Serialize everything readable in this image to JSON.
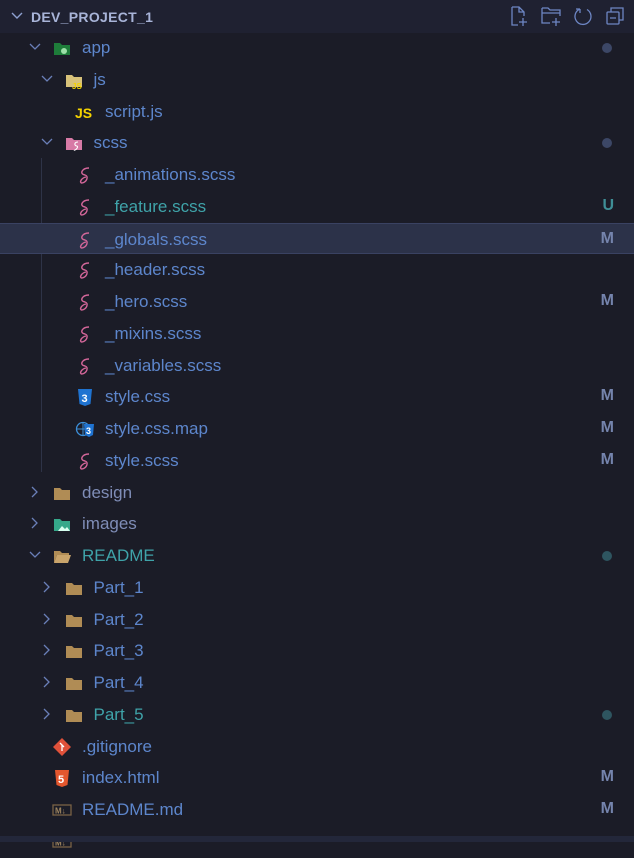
{
  "explorer": {
    "title": "DEV_PROJECT_1",
    "actions": [
      {
        "name": "new-file-button",
        "icon": "new-file-icon"
      },
      {
        "name": "new-folder-button",
        "icon": "new-folder-icon"
      },
      {
        "name": "refresh-button",
        "icon": "refresh-icon"
      },
      {
        "name": "collapse-all-button",
        "icon": "collapse-all-icon"
      }
    ]
  },
  "colors": {
    "accent": "#5d86cc",
    "untracked": "#3fa3a9",
    "selected_bg": "#2c3249"
  },
  "tree": [
    {
      "label": "app",
      "depth": 0,
      "folder": true,
      "expanded": true,
      "icon": "folder-app-icon",
      "marker": "dot"
    },
    {
      "label": "js",
      "depth": 1,
      "folder": true,
      "expanded": true,
      "icon": "folder-js-icon"
    },
    {
      "label": "script.js",
      "depth": 2,
      "icon": "javascript-icon"
    },
    {
      "label": "scss",
      "depth": 1,
      "folder": true,
      "expanded": true,
      "icon": "folder-sass-icon",
      "marker": "dot"
    },
    {
      "label": "_animations.scss",
      "depth": 2,
      "icon": "sass-icon"
    },
    {
      "label": "_feature.scss",
      "depth": 2,
      "icon": "sass-icon",
      "badge": "U",
      "style": "teal"
    },
    {
      "label": "_globals.scss",
      "depth": 2,
      "icon": "sass-icon",
      "badge": "M",
      "selected": true
    },
    {
      "label": "_header.scss",
      "depth": 2,
      "icon": "sass-icon"
    },
    {
      "label": "_hero.scss",
      "depth": 2,
      "icon": "sass-icon",
      "badge": "M"
    },
    {
      "label": "_mixins.scss",
      "depth": 2,
      "icon": "sass-icon"
    },
    {
      "label": "_variables.scss",
      "depth": 2,
      "icon": "sass-icon"
    },
    {
      "label": "style.css",
      "depth": 2,
      "icon": "css-icon",
      "badge": "M"
    },
    {
      "label": "style.css.map",
      "depth": 2,
      "icon": "css-map-icon",
      "badge": "M"
    },
    {
      "label": "style.scss",
      "depth": 2,
      "icon": "sass-icon",
      "badge": "M"
    },
    {
      "label": "design",
      "depth": 0,
      "folder": true,
      "expanded": false,
      "icon": "folder-icon",
      "style": "dim"
    },
    {
      "label": "images",
      "depth": 0,
      "folder": true,
      "expanded": false,
      "icon": "folder-images-icon",
      "style": "dim"
    },
    {
      "label": "README",
      "depth": 0,
      "folder": true,
      "expanded": true,
      "icon": "folder-open-icon",
      "style": "teal",
      "marker": "dot-teal"
    },
    {
      "label": "Part_1",
      "depth": 1,
      "folder": true,
      "expanded": false,
      "icon": "folder-icon"
    },
    {
      "label": "Part_2",
      "depth": 1,
      "folder": true,
      "expanded": false,
      "icon": "folder-icon"
    },
    {
      "label": "Part_3",
      "depth": 1,
      "folder": true,
      "expanded": false,
      "icon": "folder-icon"
    },
    {
      "label": "Part_4",
      "depth": 1,
      "folder": true,
      "expanded": false,
      "icon": "folder-icon"
    },
    {
      "label": "Part_5",
      "depth": 1,
      "folder": true,
      "expanded": false,
      "icon": "folder-icon",
      "style": "teal",
      "marker": "dot-teal"
    },
    {
      "label": ".gitignore",
      "depth": 0,
      "icon": "git-icon"
    },
    {
      "label": "index.html",
      "depth": 0,
      "icon": "html-icon",
      "badge": "M"
    },
    {
      "label": "README.md",
      "depth": 0,
      "icon": "markdown-icon",
      "badge": "M"
    },
    {
      "depth": 0,
      "icon": "markdown-icon"
    }
  ]
}
